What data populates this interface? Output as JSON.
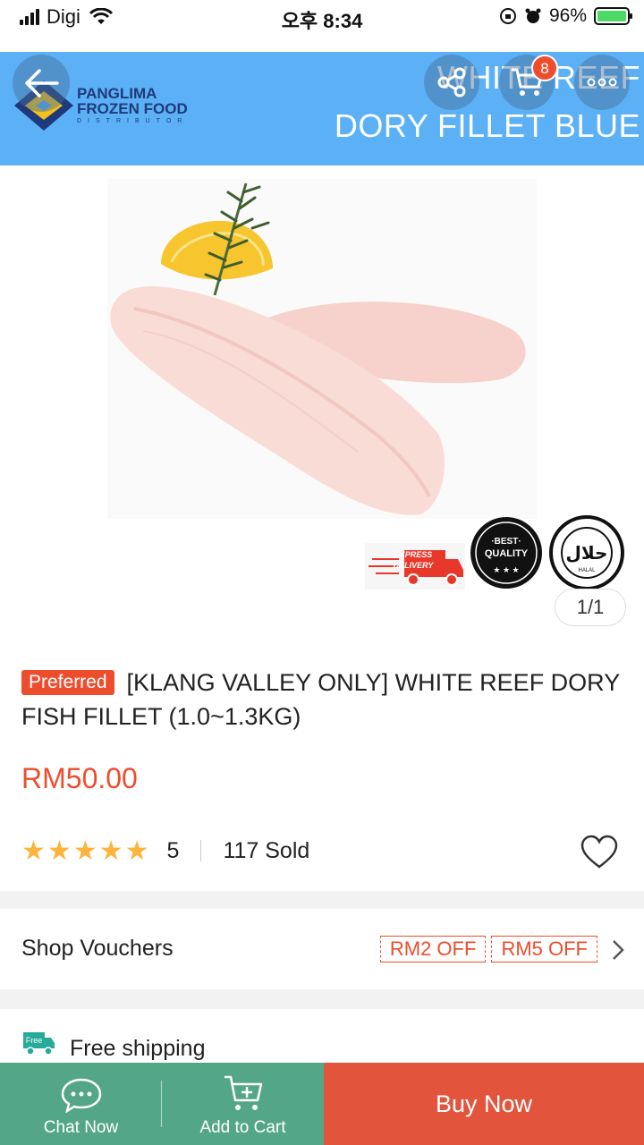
{
  "status_bar": {
    "carrier": "Digi",
    "time": "오후 8:34",
    "battery": "96%"
  },
  "banner": {
    "brand_line1": "PANGLIMA",
    "brand_line2": "FROZEN FOOD",
    "brand_sub": "DISTRIBUTOR",
    "title_line1": "WHITE REEF",
    "title_line2": "DORY FILLET BLUE",
    "cart_count": "8"
  },
  "product": {
    "image_counter": "1/1",
    "badge_express": "EXPRESS DELIVERY",
    "badge_quality": "BEST QUALITY",
    "badge_halal": "حلال",
    "preferred_label": "Preferred",
    "title": "[KLANG VALLEY ONLY] WHITE REEF DORY FISH FILLET (1.0~1.3KG)",
    "price": "RM50.00",
    "rating": "5",
    "rating_stars": 5,
    "sold": "117 Sold"
  },
  "vouchers": {
    "label": "Shop Vouchers",
    "tags": [
      "RM2 OFF",
      "RM5 OFF"
    ]
  },
  "shipping": {
    "icon_label": "Free",
    "label": "Free shipping"
  },
  "bottom_bar": {
    "chat": "Chat Now",
    "cart": "Add to Cart",
    "buy": "Buy Now"
  },
  "colors": {
    "accent": "#ee4d2d",
    "banner": "#5bb0f6",
    "bottom_green": "#54a688",
    "buy_now": "#e2543b",
    "star": "#fcb43a"
  }
}
